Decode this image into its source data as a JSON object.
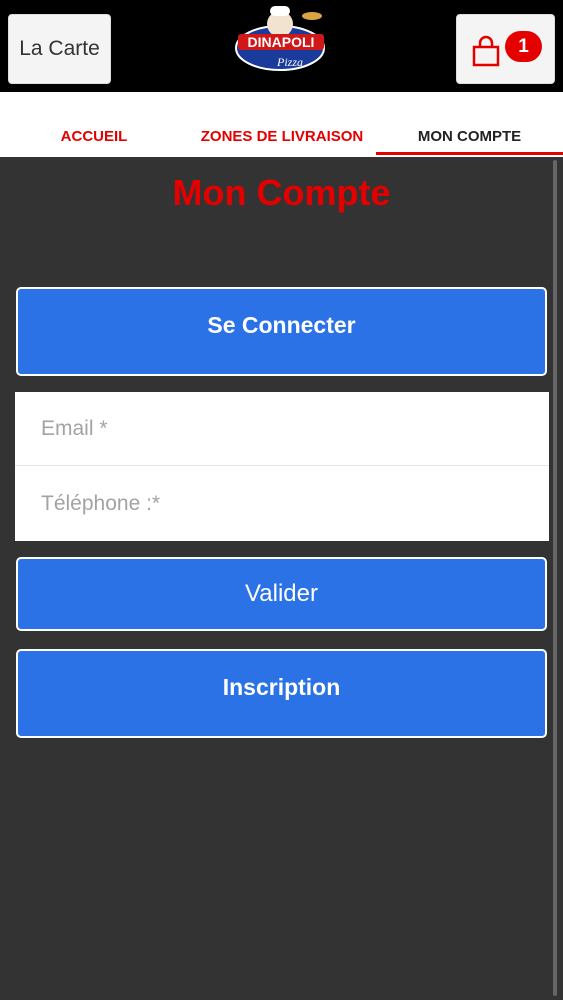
{
  "header": {
    "menu_label": "La Carte",
    "brand_name": "DINAPOLI",
    "brand_sub": "Pizza",
    "cart_count": "1"
  },
  "tabs": [
    {
      "label": "ACCUEIL",
      "active": false
    },
    {
      "label": "ZONES DE LIVRAISON",
      "active": false
    },
    {
      "label": "MON COMPTE",
      "active": true
    }
  ],
  "page": {
    "title": "Mon Compte",
    "connect_label": "Se Connecter",
    "email_placeholder": "Email *",
    "phone_placeholder": "Téléphone :*",
    "submit_label": "Valider",
    "register_label": "Inscription"
  },
  "colors": {
    "accent_red": "#e50000",
    "button_blue": "#2b72e6",
    "background": "#333333"
  }
}
